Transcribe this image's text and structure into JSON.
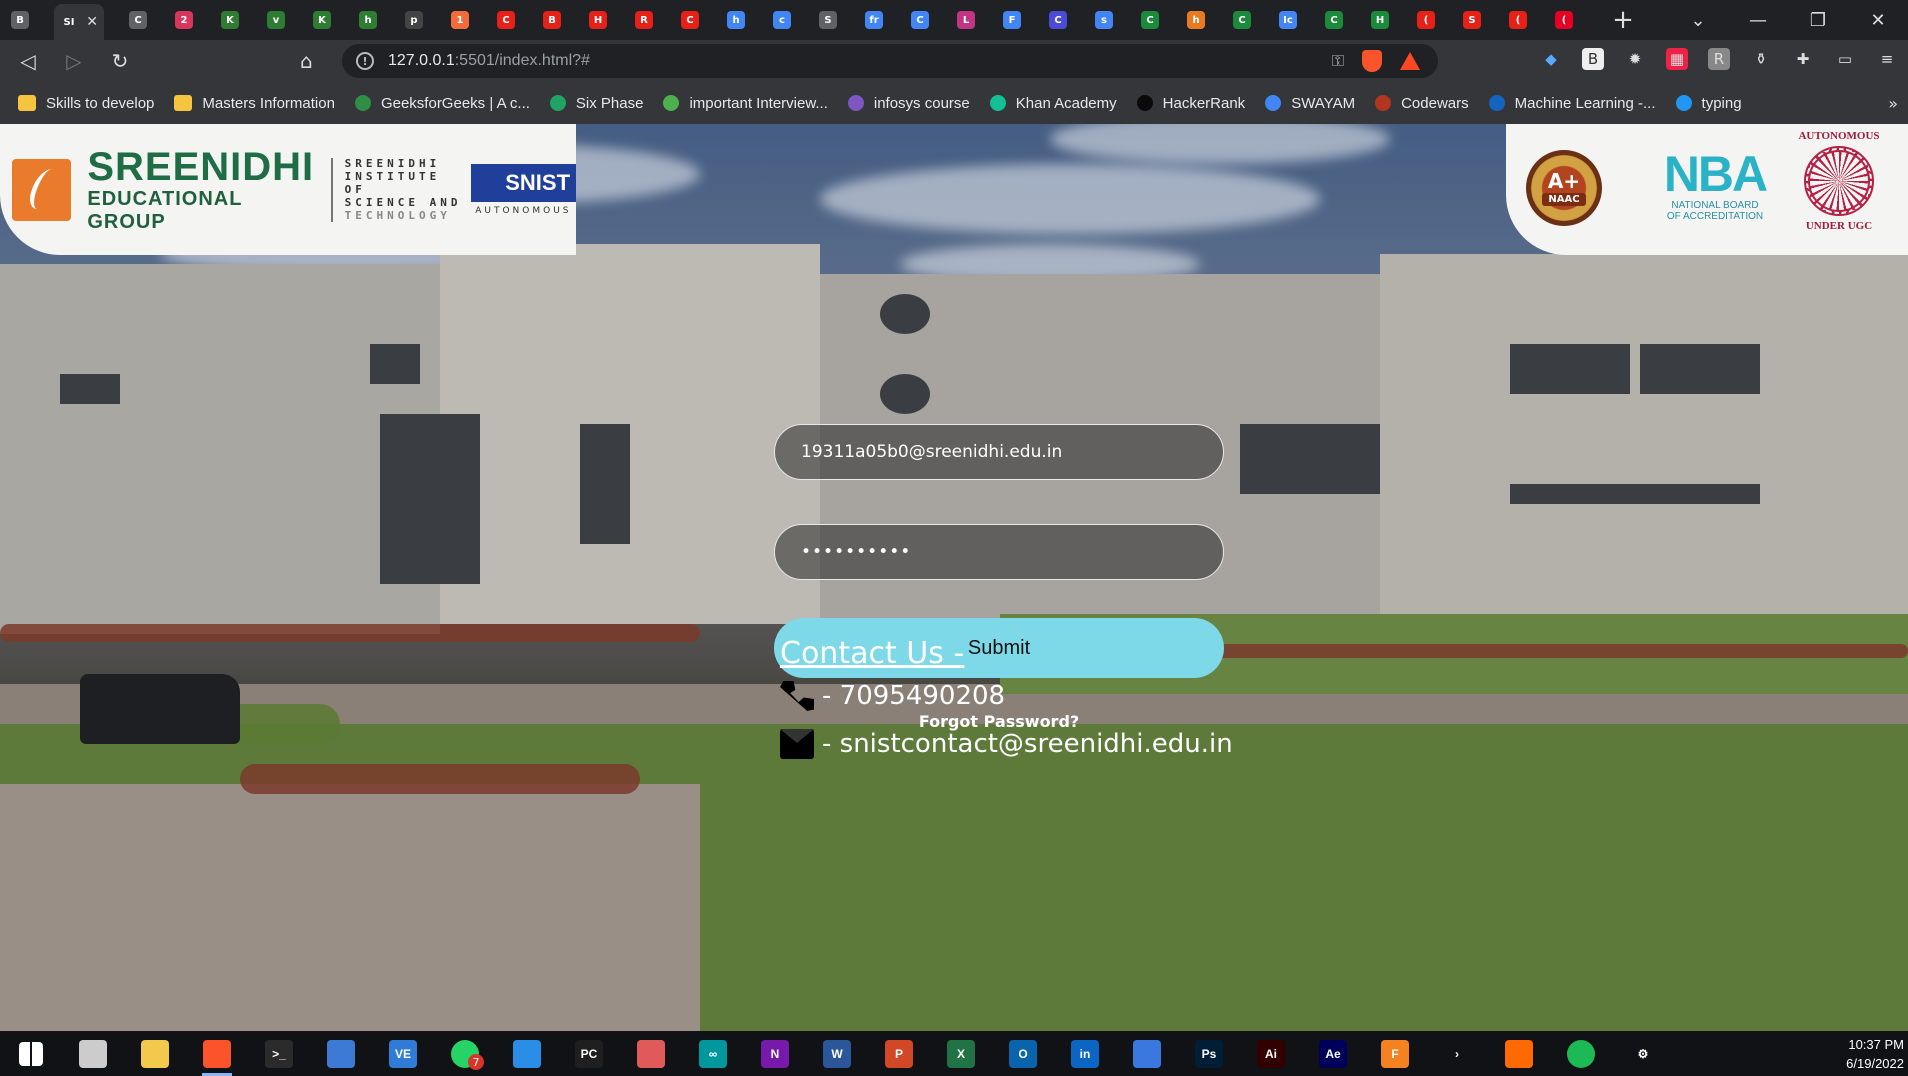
{
  "browser": {
    "tabs": [
      {
        "letter": "B",
        "color": "#5f6368"
      },
      {
        "letter": "SI",
        "color": "#35363a",
        "active": true
      },
      {
        "letter": "C",
        "color": "#5f6368"
      },
      {
        "letter": "2",
        "color": "#d8355b"
      },
      {
        "letter": "K",
        "color": "#2e7d32"
      },
      {
        "letter": "v",
        "color": "#2e7d32"
      },
      {
        "letter": "K",
        "color": "#2e7d32"
      },
      {
        "letter": "h",
        "color": "#2e7d32"
      },
      {
        "letter": "p",
        "color": "#444"
      },
      {
        "letter": "1",
        "color": "#f26b3a"
      },
      {
        "letter": "C",
        "color": "#e62117"
      },
      {
        "letter": "B",
        "color": "#e62117"
      },
      {
        "letter": "H",
        "color": "#e62117"
      },
      {
        "letter": "R",
        "color": "#e62117"
      },
      {
        "letter": "C",
        "color": "#e62117"
      },
      {
        "letter": "h",
        "color": "#4285f4"
      },
      {
        "letter": "c",
        "color": "#4285f4"
      },
      {
        "letter": "S",
        "color": "#5f6368"
      },
      {
        "letter": "fr",
        "color": "#4285f4"
      },
      {
        "letter": "C",
        "color": "#4285f4"
      },
      {
        "letter": "L",
        "color": "#c13584"
      },
      {
        "letter": "F",
        "color": "#4285f4"
      },
      {
        "letter": "C",
        "color": "#4b4bd8"
      },
      {
        "letter": "s",
        "color": "#4285f4"
      },
      {
        "letter": "C",
        "color": "#1b8a3b"
      },
      {
        "letter": "h",
        "color": "#e87b22"
      },
      {
        "letter": "C",
        "color": "#1b8a3b"
      },
      {
        "letter": "Ic",
        "color": "#4285f4"
      },
      {
        "letter": "C",
        "color": "#1b8a3b"
      },
      {
        "letter": "H",
        "color": "#1b8a3b"
      },
      {
        "letter": "(",
        "color": "#e62117"
      },
      {
        "letter": "S",
        "color": "#e62117"
      },
      {
        "letter": "(",
        "color": "#e62117"
      },
      {
        "letter": "(",
        "color": "#e60023"
      }
    ],
    "url_host": "127.0.0.1",
    "url_rest": ":5501/index.html?#",
    "bookmarks": [
      {
        "label": "Skills to develop",
        "icon": "folder",
        "color": "#f5c542"
      },
      {
        "label": "Masters Information",
        "icon": "folder",
        "color": "#f5c542"
      },
      {
        "label": "GeeksforGeeks | A c...",
        "icon": "gfg-icon",
        "color": "#2f8d46"
      },
      {
        "label": "Six Phase",
        "icon": "drive-icon",
        "color": "#1fa463"
      },
      {
        "label": "important Interview...",
        "icon": "leaf-icon",
        "color": "#4caf50"
      },
      {
        "label": "infosys course",
        "icon": "hex-icon",
        "color": "#7e57c2"
      },
      {
        "label": "Khan Academy",
        "icon": "khan-icon",
        "color": "#14bf96"
      },
      {
        "label": "HackerRank",
        "icon": "hackerrank-icon",
        "color": "#0a0a0a"
      },
      {
        "label": "SWAYAM",
        "icon": "google-icon",
        "color": "#4285f4"
      },
      {
        "label": "Codewars",
        "icon": "codewars-icon",
        "color": "#b1361e"
      },
      {
        "label": "Machine Learning -...",
        "icon": "c-icon",
        "color": "#1565c0"
      },
      {
        "label": "typing",
        "icon": "typing-icon",
        "color": "#2196f3"
      }
    ]
  },
  "header": {
    "brand_line1": "SREENIDHI",
    "brand_line2": "EDUCATIONAL GROUP",
    "snist_line1": "SREENIDHI",
    "snist_line2": "INSTITUTE OF",
    "snist_line3": "SCIENCE AND",
    "snist_line4": "TECHNOLOGY",
    "snist_badge": "SNIST",
    "snist_sub": "AUTONOMOUS",
    "naac_grade": "A+",
    "naac_label": "NAAC",
    "nba_logo": "NBA",
    "nba_line1": "NATIONAL BOARD",
    "nba_line2": "OF ACCREDITATION",
    "ugc_top": "AUTONOMOUS",
    "ugc_bottom": "UNDER UGC"
  },
  "login": {
    "email_value": "19311a05b0@sreenidhi.edu.in",
    "password_value": "••••••••••",
    "submit_label": "Submit",
    "forgot_label": "Forgot Password?"
  },
  "contact": {
    "title": "Contact Us -",
    "phone": "- 7095490208",
    "email": "- snistcontact@sreenidhi.edu.in"
  },
  "taskbar": {
    "apps": [
      {
        "name": "windows-start-icon",
        "label": "",
        "color": "#ffffff"
      },
      {
        "name": "task-view-icon",
        "label": "",
        "color": "#cccccc"
      },
      {
        "name": "file-explorer-icon",
        "label": "",
        "color": "#f2c94c"
      },
      {
        "name": "brave-browser-icon",
        "label": "",
        "color": "#fb542b",
        "active": true
      },
      {
        "name": "terminal-icon",
        "label": ">_",
        "color": "#2b2b2b"
      },
      {
        "name": "network-icon",
        "label": "",
        "color": "#3d7ad6"
      },
      {
        "name": "vs-icon",
        "label": "VE",
        "color": "#2f7bd6"
      },
      {
        "name": "whatsapp-icon",
        "label": "",
        "color": "#25d366",
        "badge": "7"
      },
      {
        "name": "vscode-icon",
        "label": "",
        "color": "#2a8ee6"
      },
      {
        "name": "pycharm-icon",
        "label": "PC",
        "color": "#1f1f1f"
      },
      {
        "name": "snipping-icon",
        "label": "",
        "color": "#e05a5a"
      },
      {
        "name": "arduino-icon",
        "label": "∞",
        "color": "#00979d"
      },
      {
        "name": "onenote-icon",
        "label": "N",
        "color": "#7719aa"
      },
      {
        "name": "word-icon",
        "label": "W",
        "color": "#2b579a"
      },
      {
        "name": "powerpoint-icon",
        "label": "P",
        "color": "#d24726"
      },
      {
        "name": "excel-icon",
        "label": "X",
        "color": "#217346"
      },
      {
        "name": "outlook-icon",
        "label": "O",
        "color": "#0a64ad"
      },
      {
        "name": "linkedin-icon",
        "label": "in",
        "color": "#0a66c2"
      },
      {
        "name": "whiteboard-icon",
        "label": "",
        "color": "#3a78e0"
      },
      {
        "name": "photoshop-icon",
        "label": "Ps",
        "color": "#001e36"
      },
      {
        "name": "illustrator-icon",
        "label": "Ai",
        "color": "#330000"
      },
      {
        "name": "aftereffects-icon",
        "label": "Ae",
        "color": "#00005b"
      },
      {
        "name": "fusion360-icon",
        "label": "F",
        "color": "#f58220"
      },
      {
        "name": "powershell-arrow-icon",
        "label": "›",
        "color": "#101215"
      },
      {
        "name": "brave-nightly-icon",
        "label": "",
        "color": "#ff6a00"
      },
      {
        "name": "spotify-icon",
        "label": "",
        "color": "#1db954"
      },
      {
        "name": "settings-icon",
        "label": "⚙",
        "color": "#101215"
      }
    ],
    "time": "10:37 PM",
    "date": "6/19/2022"
  }
}
